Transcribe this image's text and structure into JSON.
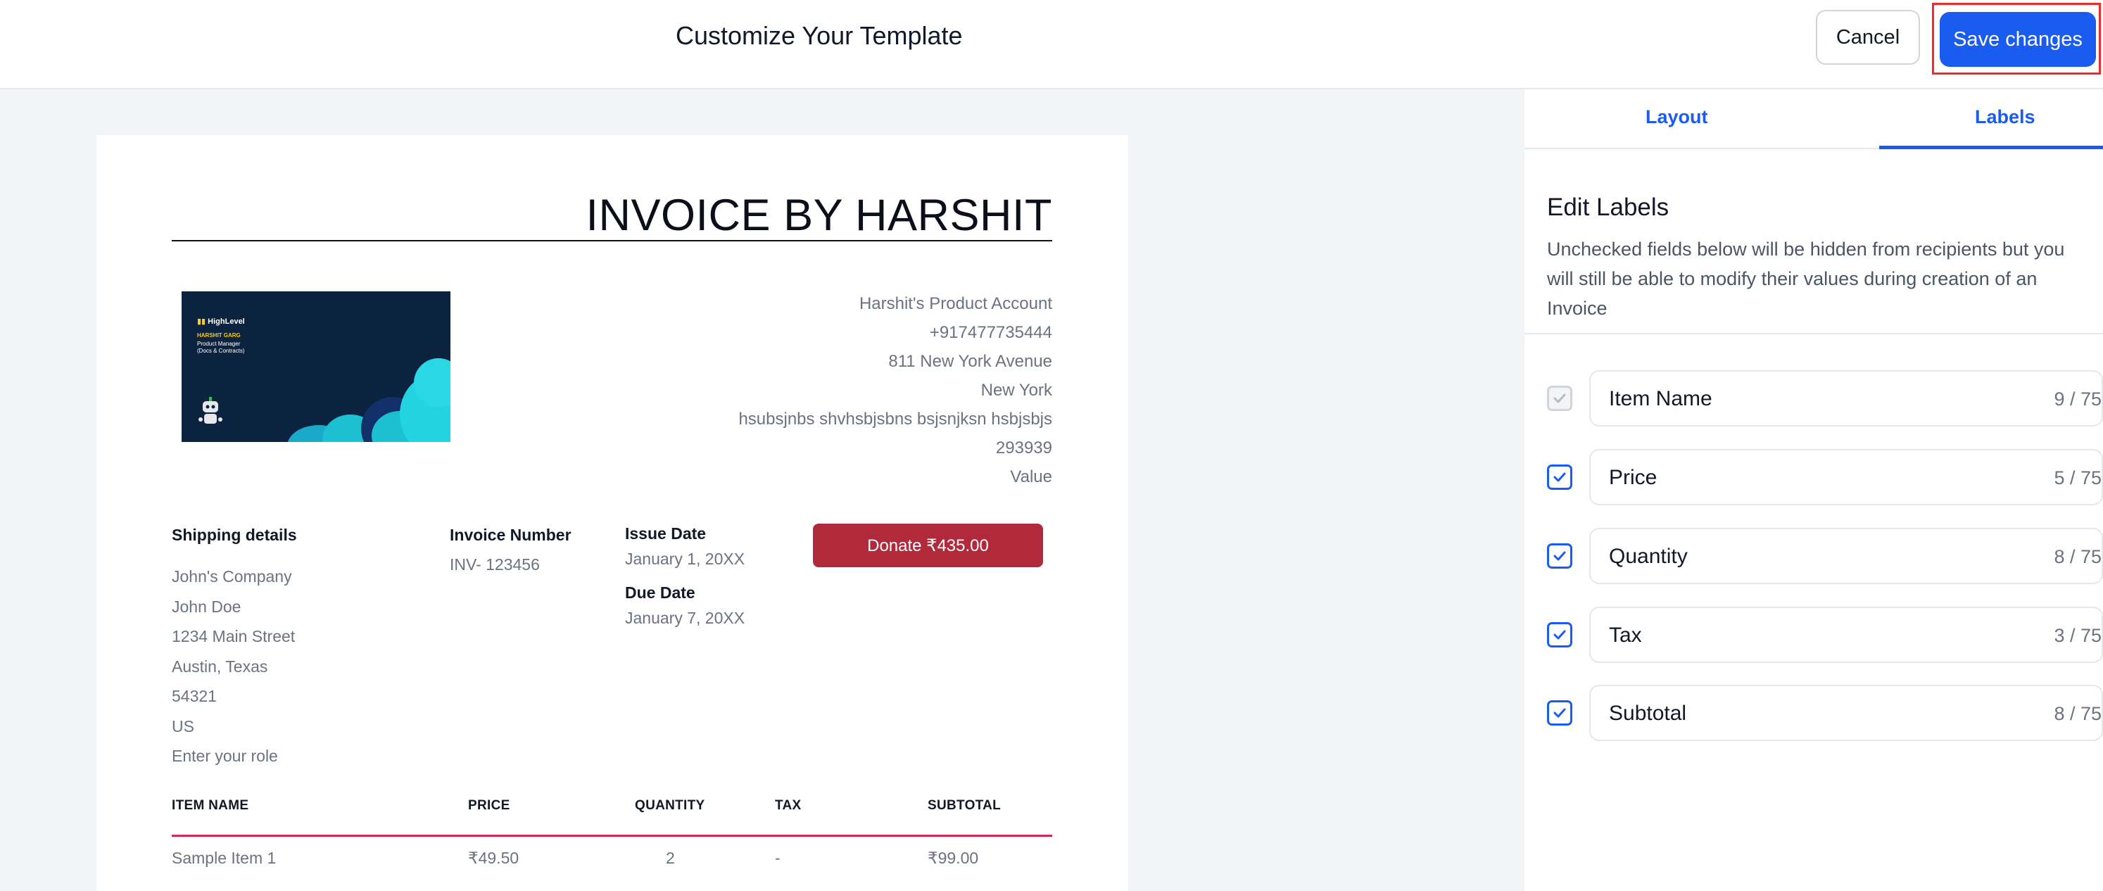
{
  "header": {
    "title": "Customize Your Template",
    "cancel_label": "Cancel",
    "save_label": "Save changes"
  },
  "invoice": {
    "title": "INVOICE BY HARSHIT",
    "logo": {
      "brand": "HighLevel",
      "person": "HARSHIT GARG",
      "role_line1": "Product Manager",
      "role_line2": "(Docs & Contracts)"
    },
    "business": [
      "Harshit's Product Account",
      "+917477735444",
      "811 New York Avenue",
      "New York",
      "hsubsjnbs shvhsbjsbns bsjsnjksn hsbjsbjs",
      "293939",
      "Value"
    ],
    "shipping": {
      "label": "Shipping details",
      "lines": [
        "John's Company",
        "John Doe",
        "1234 Main Street",
        "Austin, Texas",
        "54321",
        "US",
        "Enter your role"
      ]
    },
    "invoice_number": {
      "label": "Invoice Number",
      "value": "INV- 123456"
    },
    "issue_date": {
      "label": "Issue Date",
      "value": "January 1, 20XX"
    },
    "due_date": {
      "label": "Due Date",
      "value": "January 7, 20XX"
    },
    "donate_label": "Donate ₹435.00",
    "table": {
      "headers": [
        "ITEM NAME",
        "PRICE",
        "QUANTITY",
        "TAX",
        "SUBTOTAL"
      ],
      "rows": [
        [
          "Sample Item 1",
          "₹49.50",
          "2",
          "-",
          "₹99.00"
        ]
      ]
    }
  },
  "panel": {
    "tabs": [
      {
        "label": "Layout",
        "active": false
      },
      {
        "label": "Labels",
        "active": true
      }
    ],
    "heading": "Edit Labels",
    "description": "Unchecked fields below will be hidden from recipients but you will still be able to modify their values during creation of an Invoice",
    "fields": [
      {
        "label": "Item Name",
        "count": "9 / 75",
        "checked": true,
        "disabled": true
      },
      {
        "label": "Price",
        "count": "5 / 75",
        "checked": true,
        "disabled": false
      },
      {
        "label": "Quantity",
        "count": "8 / 75",
        "checked": true,
        "disabled": false
      },
      {
        "label": "Tax",
        "count": "3 / 75",
        "checked": true,
        "disabled": false
      },
      {
        "label": "Subtotal",
        "count": "8 / 75",
        "checked": true,
        "disabled": false
      }
    ]
  },
  "colors": {
    "accent": "#1a5cf0",
    "donate": "#b02a3c",
    "table_rule": "#cc2a52",
    "highlight": "#ef2b2b"
  }
}
